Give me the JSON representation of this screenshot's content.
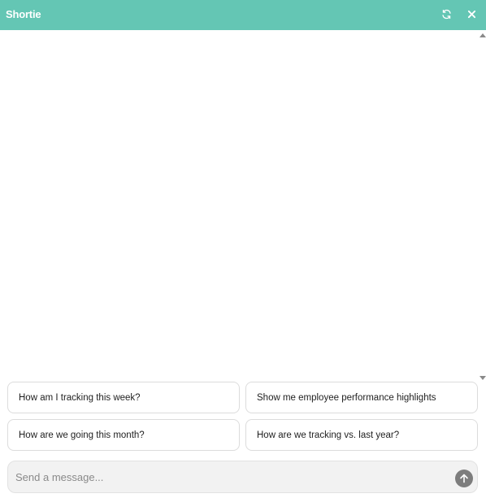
{
  "header": {
    "title": "Shortie",
    "refresh_icon": "refresh-icon",
    "close_icon": "close-icon",
    "background": "#64c6b4"
  },
  "suggestions": [
    "How am I tracking this week?",
    "Show me employee performance highlights",
    "How are we going this month?",
    "How are we tracking vs. last year?"
  ],
  "composer": {
    "placeholder": "Send a message...",
    "send_icon": "arrow-up-icon"
  }
}
